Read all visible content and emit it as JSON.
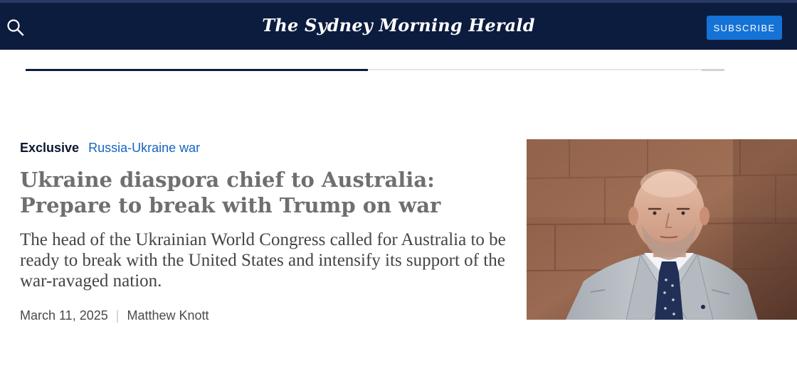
{
  "header": {
    "masthead": "The Sydney Morning Herald",
    "subscribe_label": "SUBSCRIBE",
    "search_icon": "search-icon"
  },
  "reading_progress": {
    "fraction": 0.49
  },
  "article": {
    "label": "Exclusive",
    "topic": "Russia-Ukraine war",
    "headline": "Ukraine diaspora chief to Australia: Prepare to break with Trump on war",
    "summary": "The head of the Ukrainian World Congress called for Australia to be ready to break with the United States and intensify its support of the war-ravaged nation.",
    "date": "March 11, 2025",
    "separator": "|",
    "author": "Matthew Knott"
  },
  "colors": {
    "header_bg": "#0c1c3f",
    "subscribe_bg": "#1572d6",
    "topic_link": "#1565c0"
  }
}
